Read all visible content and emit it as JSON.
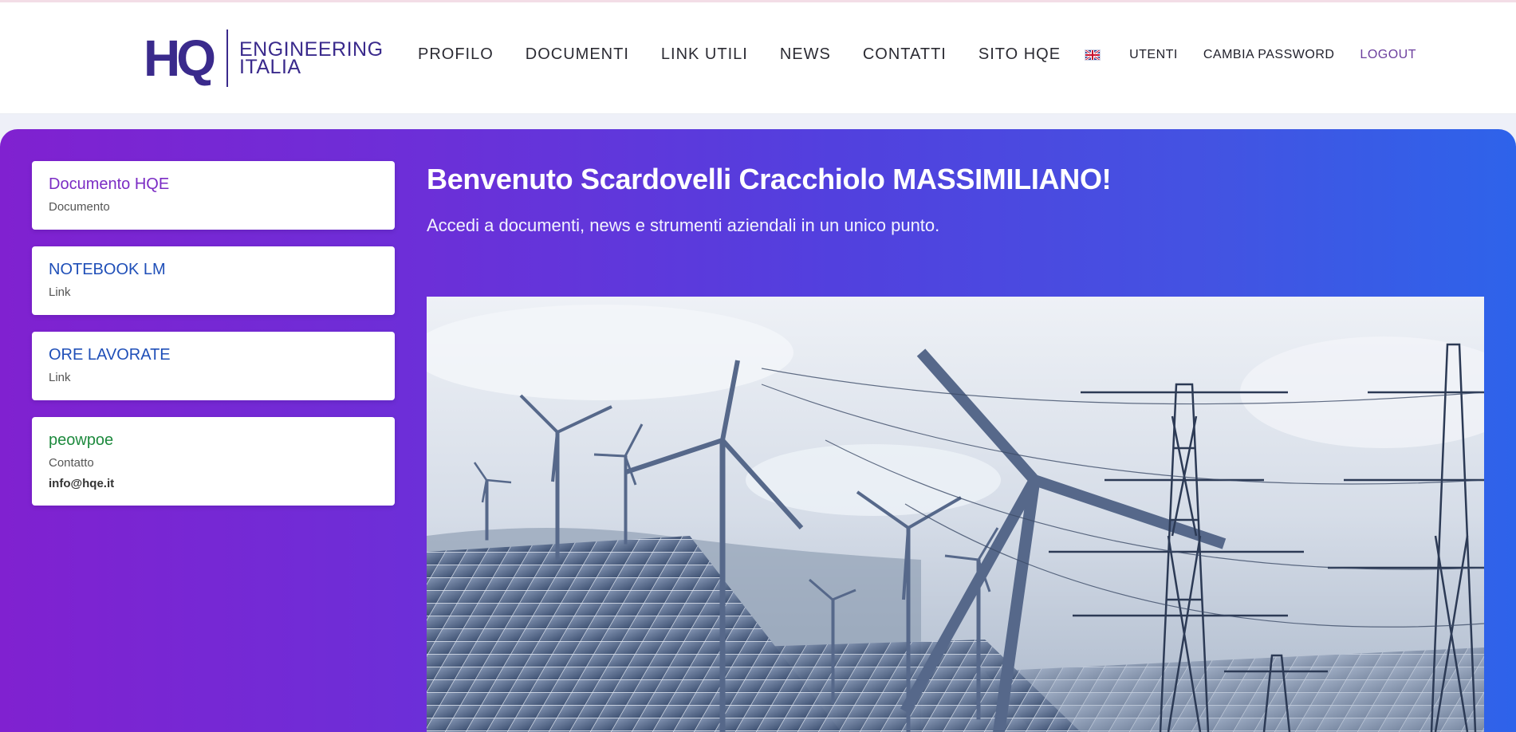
{
  "header": {
    "logo": {
      "mark": "HQ",
      "line1": "ENGINEERING",
      "line2": "ITALIA"
    },
    "nav": [
      {
        "label": "PROFILO"
      },
      {
        "label": "DOCUMENTI"
      },
      {
        "label": "LINK UTILI"
      },
      {
        "label": "NEWS"
      },
      {
        "label": "CONTATTI"
      },
      {
        "label": "SITO HQE"
      }
    ],
    "language_icon": "uk-flag-icon",
    "utenti": "UTENTI",
    "cambia_password": "CAMBIA PASSWORD",
    "logout": "LOGOUT"
  },
  "sidebar": {
    "cards": [
      {
        "title": "Documento HQE",
        "type": "Documento",
        "title_color": "#7b2cc4"
      },
      {
        "title": "NOTEBOOK LM",
        "type": "Link",
        "title_color": "#1f4fb8"
      },
      {
        "title": "ORE LAVORATE",
        "type": "Link",
        "title_color": "#1f4fb8"
      },
      {
        "title": "peowpoe",
        "type": "Contatto",
        "extra": "info@hqe.it",
        "title_color": "#1e8a3e"
      }
    ]
  },
  "main": {
    "welcome": "Benvenuto Scardovelli Cracchiolo MASSIMILIANO!",
    "subtitle": "Accedi a documenti, news e strumenti aziendali in un unico punto.",
    "banner_icon": "renewable-energy-image"
  },
  "colors": {
    "brand": "#3a2a8c",
    "gradient_start": "#8021d0",
    "gradient_end": "#2e63ea",
    "logout": "#6c3f9e"
  }
}
